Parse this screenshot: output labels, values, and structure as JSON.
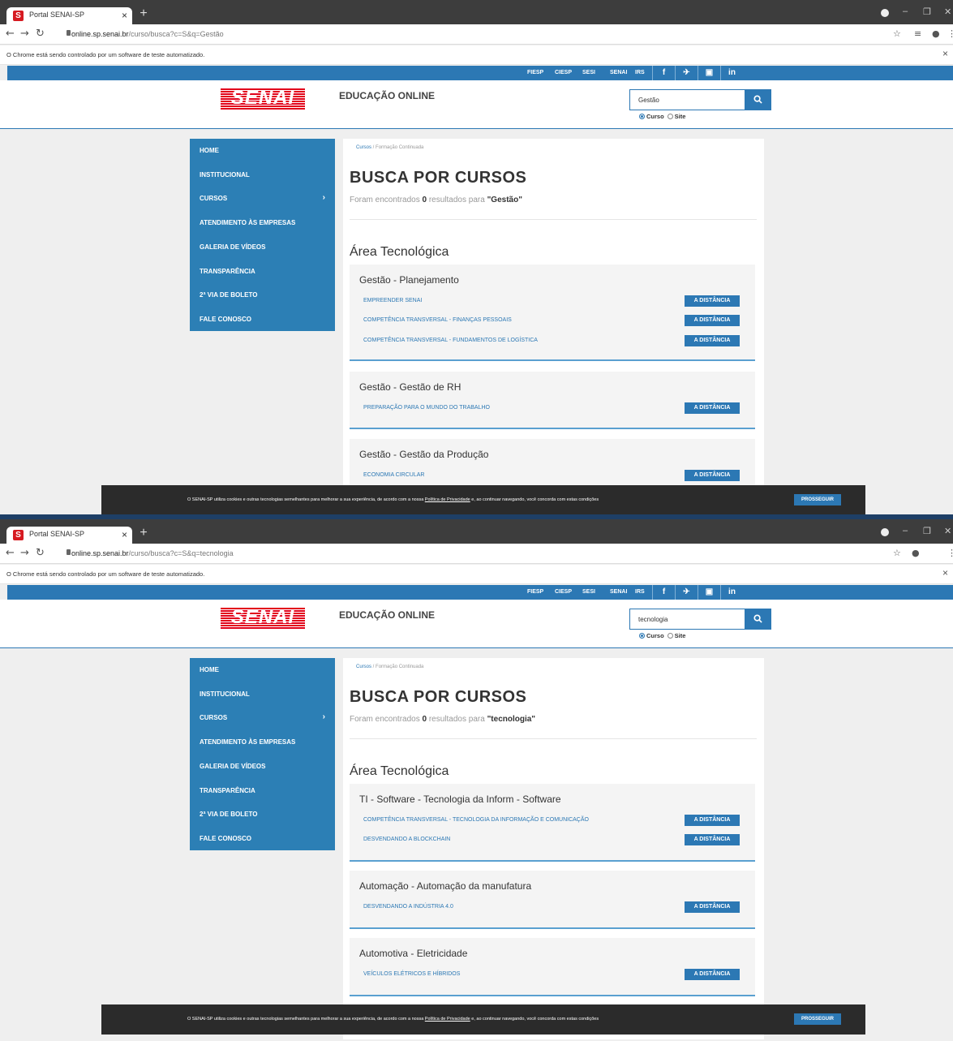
{
  "screens": [
    {
      "tab_title": "Portal SENAI-SP",
      "url_host": "online.sp.senai.br",
      "url_path": "/curso/busca?c=S&q=Gestão",
      "infobar": "O Chrome está sendo controlado por um software de teste automatizado.",
      "search_value": "Gestão",
      "results_prefix": "Foram encontrados",
      "results_count": "0",
      "results_mid": "resultados para",
      "results_query": "\"Gestão\"",
      "groups": [
        {
          "title": "Gestão - Planejamento",
          "courses": [
            "EMPREENDER SENAI",
            "COMPETÊNCIA TRANSVERSAL - FINANÇAS PESSOAIS",
            "COMPETÊNCIA TRANSVERSAL - FUNDAMENTOS DE LOGÍSTICA"
          ]
        },
        {
          "title": "Gestão - Gestão de RH",
          "courses": [
            "PREPARAÇÃO PARA O MUNDO DO TRABALHO"
          ]
        },
        {
          "title": "Gestão - Gestão da Produção",
          "courses": [
            "ECONOMIA CIRCULAR"
          ]
        }
      ]
    },
    {
      "tab_title": "Portal SENAI-SP",
      "url_host": "online.sp.senai.br",
      "url_path": "/curso/busca?c=S&q=tecnologia",
      "infobar": "O Chrome está sendo controlado por um software de teste automatizado.",
      "search_value": "tecnologia",
      "results_prefix": "Foram encontrados",
      "results_count": "0",
      "results_mid": "resultados para",
      "results_query": "\"tecnologia\"",
      "groups": [
        {
          "title": "TI - Software - Tecnologia da Inform - Software",
          "courses": [
            "COMPETÊNCIA TRANSVERSAL - TECNOLOGIA DA INFORMAÇÃO E COMUNICAÇÃO",
            "DESVENDANDO A BLOCKCHAIN"
          ]
        },
        {
          "title": "Automação - Automação da manufatura",
          "courses": [
            "DESVENDANDO A INDÚSTRIA 4.0"
          ]
        },
        {
          "title": "Automotiva - Eletricidade",
          "courses": [
            "VEÍCULOS ELÉTRICOS E HÍBRIDOS"
          ]
        }
      ]
    }
  ],
  "top_links": [
    "FIESP",
    "CIESP",
    "SESI",
    "SENAI",
    "IRS"
  ],
  "social": [
    "f",
    "t",
    "yt",
    "in"
  ],
  "logo": "SENAI",
  "edu_label": "EDUCAÇÃO ONLINE",
  "radio_curso": "Curso",
  "radio_site": "Site",
  "sidebar": [
    "HOME",
    "INSTITUCIONAL",
    "CURSOS",
    "ATENDIMENTO ÀS EMPRESAS",
    "GALERIA DE VÍDEOS",
    "TRANSPARÊNCIA",
    "2ª VIA DE BOLETO",
    "FALE CONOSCO"
  ],
  "breadcrumb": [
    "Cursos",
    "Formação Continuada"
  ],
  "page_title": "BUSCA POR CURSOS",
  "area_title": "Área Tecnológica",
  "badge": "A DISTÂNCIA",
  "cookie_before": "O SENAI-SP utiliza cookies e outras tecnologias semelhantes para melhorar a sua experiência, de acordo com a nossa",
  "cookie_link": "Política de Privacidade",
  "cookie_after": "e, ao continuar navegando, você concorda com estas condições",
  "cookie_button": "PROSSEGUIR",
  "colors": {
    "primary": "#2c78b4",
    "sidebar": "#2c7fb5",
    "logo_red": "#e2001a",
    "chrome_dark": "#3d3d3d"
  }
}
